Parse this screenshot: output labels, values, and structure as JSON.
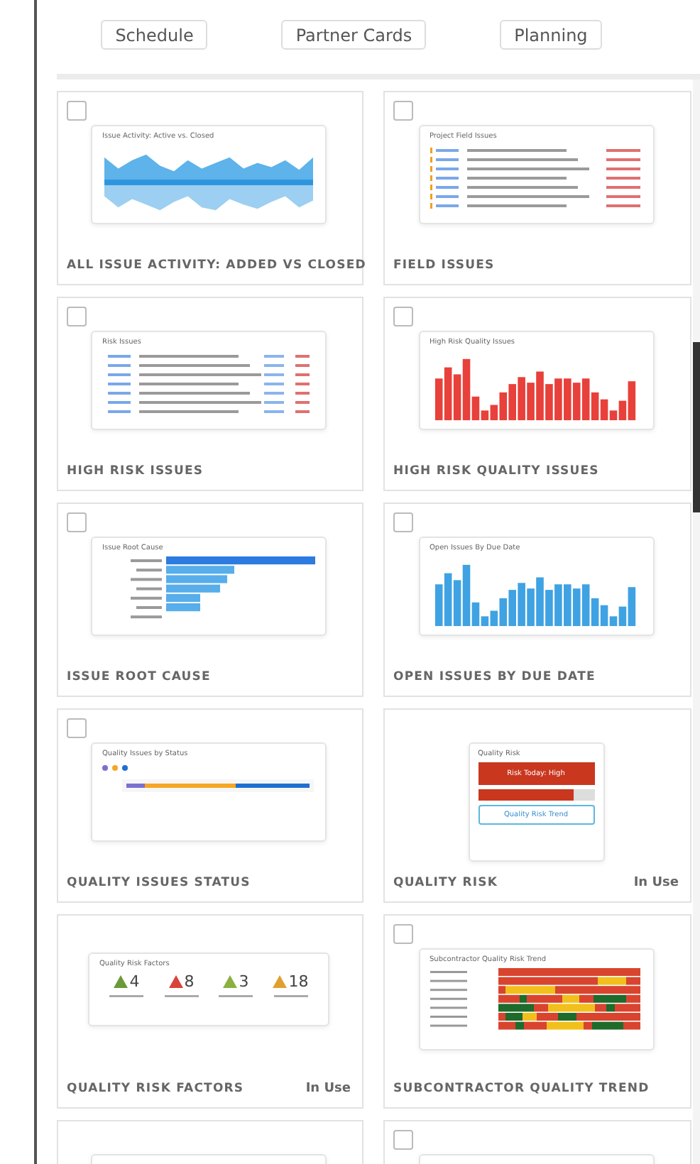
{
  "nav_buttons": [
    {
      "label": "Schedule"
    },
    {
      "label": "Partner Cards"
    },
    {
      "label": "Planning"
    }
  ],
  "cards": [
    {
      "title": "ALL ISSUE ACTIVITY: ADDED VS CLOSED",
      "checked": false,
      "preview": {
        "kind": "area",
        "title": "Issue Activity: Active vs. Closed"
      }
    },
    {
      "title": "FIELD ISSUES",
      "checked": false,
      "preview": {
        "kind": "field_table",
        "title": "Project Field Issues"
      }
    },
    {
      "title": "HIGH RISK ISSUES",
      "checked": false,
      "preview": {
        "kind": "risk_table",
        "title": "Risk Issues"
      }
    },
    {
      "title": "HIGH RISK QUALITY ISSUES",
      "checked": false,
      "preview": {
        "kind": "bars",
        "title": "High Risk Quality Issues",
        "color": "#e8403a"
      }
    },
    {
      "title": "ISSUE ROOT CAUSE",
      "checked": false,
      "preview": {
        "kind": "hbars",
        "title": "Issue Root Cause"
      }
    },
    {
      "title": "OPEN ISSUES BY DUE DATE",
      "checked": false,
      "preview": {
        "kind": "bars",
        "title": "Open Issues By Due Date",
        "color": "#3fa2e2"
      }
    },
    {
      "title": "QUALITY ISSUES STATUS",
      "checked": false,
      "preview": {
        "kind": "status",
        "title": "Quality Issues by Status",
        "dots": [
          {
            "color": "#7b6fd0"
          },
          {
            "color": "#f5a623"
          },
          {
            "color": "#1f6fd1"
          }
        ]
      }
    },
    {
      "title": "QUALITY RISK",
      "status": "In Use",
      "preview": {
        "kind": "risk",
        "title": "Quality Risk",
        "banner": "Risk Today: High",
        "level": 0.82,
        "button": "Quality Risk Trend"
      }
    },
    {
      "title": "QUALITY RISK FACTORS",
      "status": "In Use",
      "preview": {
        "kind": "factors",
        "title": "Quality Risk Factors",
        "items": [
          {
            "value": "4",
            "color": "#6a9a3a"
          },
          {
            "value": "8",
            "color": "#d9443a"
          },
          {
            "value": "3",
            "color": "#8ab040"
          },
          {
            "value": "18",
            "color": "#e0a030"
          }
        ]
      }
    },
    {
      "title": "SUBCONTRACTOR QUALITY TREND",
      "checked": false,
      "preview": {
        "kind": "heatmap",
        "title": "Subcontractor Quality Risk Trend"
      }
    },
    {
      "preview": {
        "kind": "heading"
      }
    },
    {
      "checked": false,
      "preview": {
        "kind": "heading"
      }
    }
  ]
}
